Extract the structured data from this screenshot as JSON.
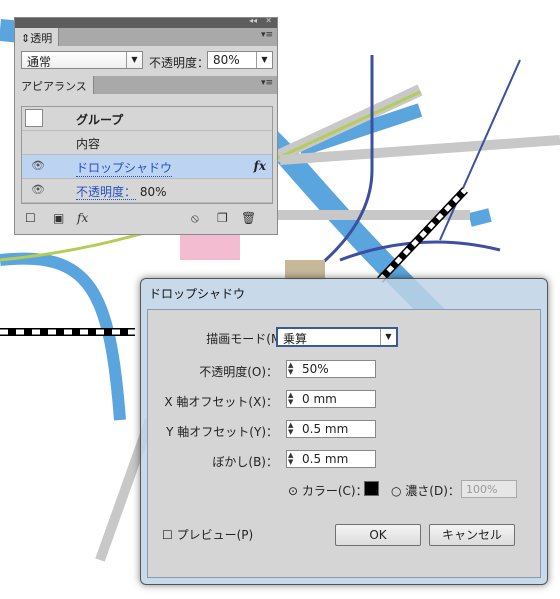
{
  "transparency_panel": {
    "tab": "透明",
    "blend_mode": "通常",
    "opacity_label": "不透明度：",
    "opacity_value": "80%"
  },
  "appearance_panel": {
    "tab": "アピアランス",
    "rows": [
      {
        "label": "グループ"
      },
      {
        "label": "内容"
      },
      {
        "label": "ドロップシャドウ",
        "fx": "fx"
      },
      {
        "label": "不透明度：",
        "value": "80%"
      }
    ],
    "fx_menu": "fx"
  },
  "dialog": {
    "title": "ドロップシャドウ",
    "mode_label": "描画モード(M)：",
    "mode_value": "乗算",
    "opacity_label": "不透明度(O)：",
    "opacity_value": "50%",
    "x_label": "X 軸オフセット(X)：",
    "x_value": "0 mm",
    "y_label": "Y 軸オフセット(Y)：",
    "y_value": "0.5 mm",
    "blur_label": "ぼかし(B)：",
    "blur_value": "0.5 mm",
    "color_label": "カラー(C)：",
    "color_value": "#000000",
    "darkness_label": "濃さ(D)：",
    "darkness_value": "100%",
    "preview_label": "プレビュー(P)",
    "ok": "OK",
    "cancel": "キャンセル"
  }
}
